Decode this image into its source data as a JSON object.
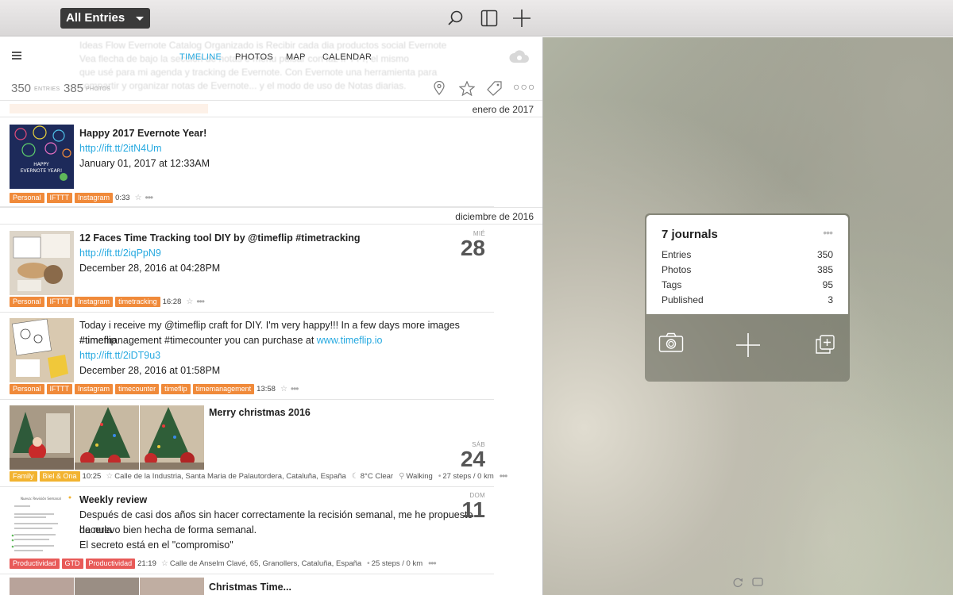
{
  "titlebar": {
    "journal_select": "All Entries",
    "icons": [
      "search-icon",
      "sidebar-icon",
      "plus-icon"
    ]
  },
  "ghost_text": [
    "Ideas Flow Evernote Catalog Organizado is Recibir cada dia productos social Evernote",
    "Vea flecha de bajo la sección de notas e menu pulsar con luz IFTTT, el mismo",
    "que usé para mi agenda y tracking de Evernote. Con Evernote una herramienta para",
    "compartir y organizar notas de Evernote... y el modo de uso de Notas diarias."
  ],
  "nav": {
    "tabs": [
      "TIMELINE",
      "PHOTOS",
      "MAP",
      "CALENDAR"
    ],
    "active_tab": "TIMELINE"
  },
  "stats": {
    "entries_count": "350",
    "entries_label": "ENTRIES",
    "photos_count": "385",
    "photos_label": "PHOTOS"
  },
  "months": {
    "jan2017": "enero de 2017",
    "dec2016": "diciembre de 2016"
  },
  "entries": [
    {
      "title": "Happy 2017 Evernote Year!",
      "link": "http://ift.tt/2itN4Um",
      "date": "January 01, 2017 at 12:33AM",
      "tags": [
        "Personal",
        "IFTTT",
        "Instagram"
      ],
      "time": "0:33",
      "thumb_text": "HAPPY EVERNOTE YEAR!"
    },
    {
      "title": "12 Faces Time Tracking tool DIY by @timeflip #timetracking",
      "link": "http://ift.tt/2iqPpN9",
      "date": "December 28, 2016 at 04:28PM",
      "tags": [
        "Personal",
        "IFTTT",
        "Instagram",
        "timetracking"
      ],
      "time": "16:28",
      "day_name": "MIÉ",
      "day_num": "28"
    },
    {
      "body1": "Today i receive my @timeflip craft for DIY. I'm very happy!!! In a few days more images #timeflip",
      "body2_pre": "#timemanagement #timecounter you can purchase at ",
      "body2_link": "www.timeflip.io",
      "link": "http://ift.tt/2iDT9u3",
      "date": "December 28, 2016 at 01:58PM",
      "tags": [
        "Personal",
        "IFTTT",
        "Instagram",
        "timecounter",
        "timeflip",
        "timemanagement"
      ],
      "time": "13:58"
    },
    {
      "title": "Merry christmas 2016",
      "tags": [
        "Family",
        "Biel & Ona"
      ],
      "time": "10:25",
      "location": "Calle de la Industria, Santa Maria de Palautordera, Cataluña, España",
      "weather": "8°C Clear",
      "activity": "Walking",
      "steps": "27 steps / 0 km",
      "day_name": "SÁB",
      "day_num": "24"
    },
    {
      "title": "Weekly review",
      "body1": "Después de casi dos años sin hacer correctamente la recisión semanal, me he propuesto hacerla",
      "body2": "de nuevo bien hecha de forma semanal.",
      "body3": "El secreto está en el \"compromiso\"",
      "tags": [
        "Productividad",
        "GTD",
        "Productividad"
      ],
      "time": "21:19",
      "location": "Calle de Anselm Clavé, 65, Granollers, Cataluña, España",
      "steps": "25 steps / 0 km",
      "day_name": "DOM",
      "day_num": "11",
      "thumb_title": "Nueva: Revisión Semanal"
    },
    {
      "title": "Christmas Time..."
    }
  ],
  "journals_card": {
    "title": "7 journals",
    "rows": [
      {
        "label": "Entries",
        "value": "350"
      },
      {
        "label": "Photos",
        "value": "385"
      },
      {
        "label": "Tags",
        "value": "95"
      },
      {
        "label": "Published",
        "value": "3"
      }
    ],
    "buttons": [
      "camera-icon",
      "plus-icon",
      "duplicate-icon"
    ]
  }
}
